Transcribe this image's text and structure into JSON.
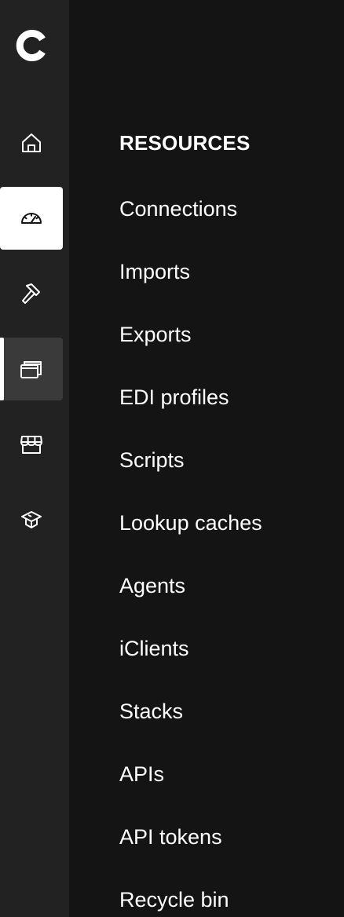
{
  "brand": {
    "logo_letter": "c",
    "logo_icon": "celigo-c-logo"
  },
  "rail": {
    "items": [
      {
        "icon": "home-icon",
        "state": "default"
      },
      {
        "icon": "dashboard-gauge-icon",
        "state": "hover-highlight"
      },
      {
        "icon": "hammer-tools-icon",
        "state": "default"
      },
      {
        "icon": "resources-stack-icon",
        "state": "active"
      },
      {
        "icon": "marketplace-store-icon",
        "state": "default"
      },
      {
        "icon": "graduation-cap-icon",
        "state": "default"
      }
    ]
  },
  "menu": {
    "heading": "RESOURCES",
    "items": [
      {
        "label": "Connections"
      },
      {
        "label": "Imports"
      },
      {
        "label": "Exports"
      },
      {
        "label": "EDI profiles"
      },
      {
        "label": "Scripts"
      },
      {
        "label": "Lookup caches"
      },
      {
        "label": "Agents"
      },
      {
        "label": "iClients"
      },
      {
        "label": "Stacks"
      },
      {
        "label": "APIs"
      },
      {
        "label": "API tokens"
      },
      {
        "label": "Recycle bin"
      }
    ]
  },
  "colors": {
    "rail_bg": "#222222",
    "menu_bg": "#141414",
    "active_bg": "#3a3a3a",
    "highlight_bg": "#ffffff",
    "text": "#ffffff"
  }
}
